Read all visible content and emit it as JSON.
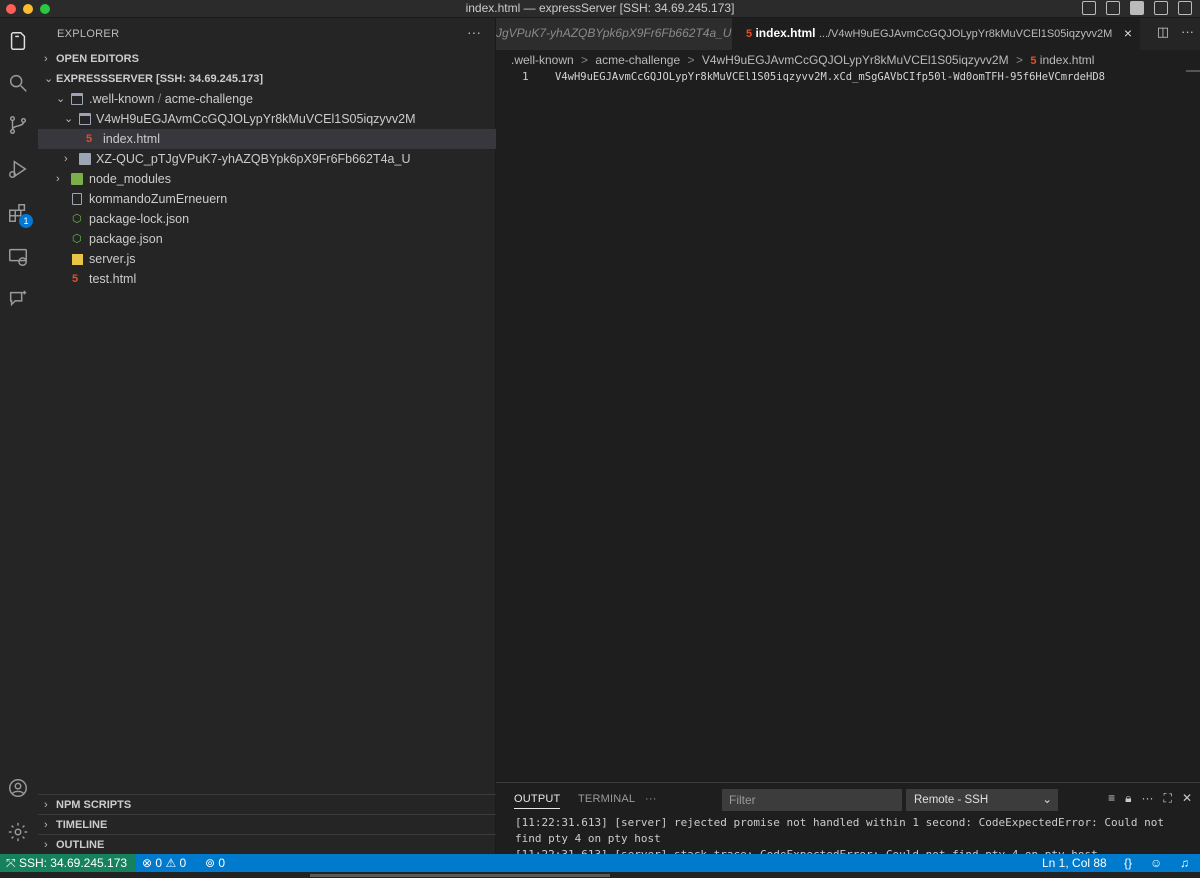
{
  "window": {
    "title": "index.html — expressServer [SSH: 34.69.245.173]"
  },
  "activity_bar": {
    "extensions_badge": "1",
    "icons": [
      "explorer-icon",
      "search-icon",
      "source-control-icon",
      "run-debug-icon",
      "extensions-icon",
      "remote-explorer-icon",
      "chat-icon",
      "account-icon",
      "settings-gear-icon"
    ]
  },
  "sidebar": {
    "header": "EXPLORER",
    "more": "···",
    "open_editors": "OPEN EDITORS",
    "workspace": "EXPRESSSERVER [SSH: 34.69.245.173]",
    "tree": {
      "well_known": ".well-known",
      "well_known_sep": "/",
      "acme": "acme-challenge",
      "token_folder": "V4wH9uEGJAvmCcGQJOLypYr8kMuVCEl1S05iqzyvv2M",
      "index_html": "index.html",
      "other_token_folder": "XZ-QUC_pTJgVPuK7-yhAZQBYpk6pX9Fr6Fb662T4a_U",
      "node_modules": "node_modules",
      "kommando": "kommandoZumErneuern",
      "package_lock": "package-lock.json",
      "package_json": "package.json",
      "server_js": "server.js",
      "test_html": "test.html"
    },
    "npm_scripts": "NPM SCRIPTS",
    "timeline": "TIMELINE",
    "outline": "OUTLINE"
  },
  "tabs": {
    "inactive": "JgVPuK7-yhAZQBYpk6pX9Fr6Fb662T4a_U",
    "active_name": "index.html",
    "active_path": ".../V4wH9uEGJAvmCcGQJOLypYr8kMuVCEl1S05iqzyvv2M",
    "close": "×"
  },
  "breadcrumbs": {
    "p1": ".well-known",
    "p2": "acme-challenge",
    "p3": "V4wH9uEGJAvmCcGQJOLypYr8kMuVCEl1S05iqzyvv2M",
    "p4": "index.html",
    "sep": ">"
  },
  "editor": {
    "line_number": "1",
    "line_content": "V4wH9uEGJAvmCcGQJOLypYr8kMuVCEl1S05iqzyvv2M.xCd_mSgGAVbCIfp50l-Wd0omTFH-95f6HeVCmrdeHD8"
  },
  "panel": {
    "tab_output": "OUTPUT",
    "tab_terminal": "TERMINAL",
    "more": "···",
    "filter_placeholder": "Filter",
    "channel": "Remote - SSH",
    "lines": [
      "[11:22:31.613] [server] rejected promise not handled within 1 second: CodeExpectedError: Could not",
      "find pty 4 on pty host",
      "[11:22:31.613] [server] stack trace: CodeExpectedError: Could not find pty 4 on pty host"
    ]
  },
  "status_bar": {
    "remote": "SSH: 34.69.245.173",
    "errors": "0",
    "warnings": "0",
    "ports": "0",
    "position": "Ln 1, Col 88"
  },
  "colors": {
    "status_bar": "#007acc",
    "remote_indicator": "#16825d",
    "html_icon": "#e44d26",
    "badge": "#0078d4"
  }
}
